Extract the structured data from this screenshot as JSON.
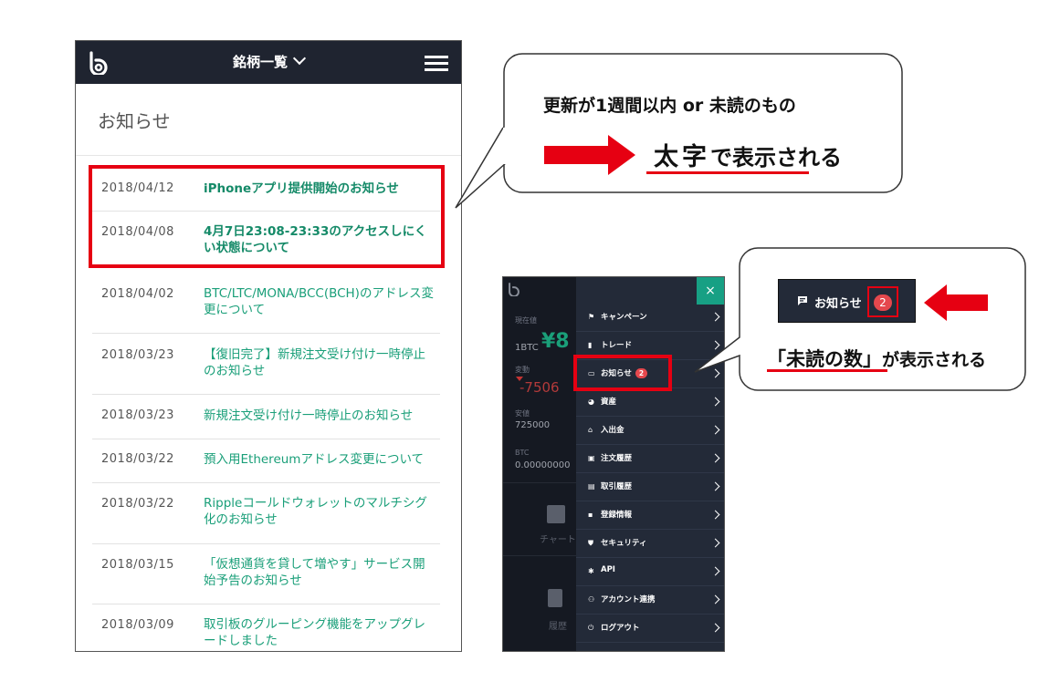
{
  "phone1": {
    "header_title": "銘柄一覧",
    "heading": "お知らせ",
    "notices": [
      {
        "date": "2018/04/12",
        "title": "iPhoneアプリ提供開始のお知らせ",
        "unread": true
      },
      {
        "date": "2018/04/08",
        "title": "4月7日23:08-23:33のアクセスしにくい状態について",
        "unread": true
      },
      {
        "date": "2018/04/02",
        "title": "BTC/LTC/MONA/BCC(BCH)のアドレス変更について",
        "unread": false
      },
      {
        "date": "2018/03/23",
        "title": "【復旧完了】新規注文受け付け一時停止のお知らせ",
        "unread": false
      },
      {
        "date": "2018/03/23",
        "title": "新規注文受け付け一時停止のお知らせ",
        "unread": false
      },
      {
        "date": "2018/03/22",
        "title": "預入用Ethereumアドレス変更について",
        "unread": false
      },
      {
        "date": "2018/03/22",
        "title": "Rippleコールドウォレットのマルチシグ化のお知らせ",
        "unread": false
      },
      {
        "date": "2018/03/15",
        "title": "「仮想通貨を貸して増やす」サービス開始予告のお知らせ",
        "unread": false
      },
      {
        "date": "2018/03/09",
        "title": "取引板のグルーピング機能をアップグレードしました",
        "unread": false
      }
    ]
  },
  "callout1": {
    "line1": "更新が1週間以内 or 未読のもの",
    "bold_word": "太字",
    "rest": "で表示される"
  },
  "phone2": {
    "left": {
      "price_label": "現在値",
      "pair": "1BTC",
      "price_partial": "¥8",
      "change_label": "変動",
      "change_partial": "-7506",
      "low_label": "安値",
      "low_value": "725000",
      "btc_label": "BTC",
      "btc_value": "0.00000000",
      "chart_label": "チャート",
      "history_label": "履歴"
    },
    "close_label": "×",
    "menu": [
      {
        "label": "キャンペーン",
        "icon": "flag-icon"
      },
      {
        "label": "トレード",
        "icon": "bar-chart-icon"
      },
      {
        "label": "お知らせ",
        "icon": "message-icon",
        "badge": "2"
      },
      {
        "label": "資産",
        "icon": "pie-chart-icon"
      },
      {
        "label": "入出金",
        "icon": "bank-icon"
      },
      {
        "label": "注文履歴",
        "icon": "order-icon"
      },
      {
        "label": "取引履歴",
        "icon": "trade-history-icon"
      },
      {
        "label": "登録情報",
        "icon": "profile-icon"
      },
      {
        "label": "セキュリティ",
        "icon": "shield-icon"
      },
      {
        "label": "API",
        "icon": "gear-icon"
      },
      {
        "label": "アカウント連携",
        "icon": "people-icon"
      },
      {
        "label": "ログアウト",
        "icon": "power-icon"
      }
    ]
  },
  "callout2": {
    "button_label": "お知らせ",
    "badge": "2",
    "caption_quoted": "「未読の数」",
    "caption_rest": "が表示される"
  },
  "colors": {
    "accent_red": "#e60012",
    "link_green": "#1a9f79",
    "header_dark": "#1f2430",
    "menu_dark": "#232a38"
  }
}
